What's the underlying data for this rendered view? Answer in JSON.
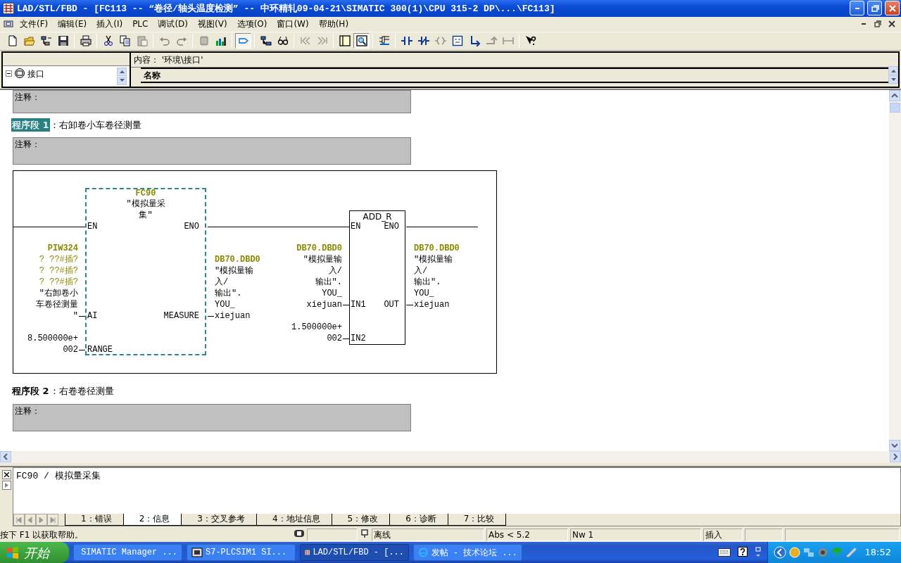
{
  "window": {
    "title": "LAD/STL/FBD  - [FC113 -- “卷径/轴头温度检测” -- 中环精轧09-04-21\\SIMATIC 300(1)\\CPU 315-2 DP\\...\\FC113]"
  },
  "menu": [
    "文件(F)",
    "编辑(E)",
    "插入(I)",
    "PLC",
    "调试(D)",
    "视图(V)",
    "选项(O)",
    "窗口(W)",
    "帮助(H)"
  ],
  "toolbar": [
    {
      "kind": "new",
      "disabled": false,
      "pressed": false
    },
    {
      "kind": "open",
      "disabled": false,
      "pressed": false
    },
    {
      "kind": "nodes",
      "disabled": false,
      "pressed": false
    },
    {
      "kind": "save",
      "disabled": false,
      "pressed": false
    },
    {
      "kind": "print",
      "disabled": false,
      "pressed": false
    },
    {
      "kind": "cut",
      "disabled": false,
      "pressed": false
    },
    {
      "kind": "copy",
      "disabled": false,
      "pressed": false
    },
    {
      "kind": "paste",
      "disabled": true,
      "pressed": false
    },
    {
      "kind": "undo",
      "disabled": true,
      "pressed": false
    },
    {
      "kind": "redo",
      "disabled": true,
      "pressed": false
    },
    {
      "kind": "chip",
      "disabled": true,
      "pressed": false
    },
    {
      "kind": "download",
      "disabled": false,
      "pressed": false
    },
    {
      "kind": "monitor",
      "disabled": false,
      "pressed": true
    },
    {
      "kind": "network",
      "disabled": false,
      "pressed": false
    },
    {
      "kind": "glasses",
      "disabled": false,
      "pressed": false
    },
    {
      "kind": "prev",
      "disabled": true,
      "pressed": false
    },
    {
      "kind": "next",
      "disabled": true,
      "pressed": false
    },
    {
      "kind": "overview",
      "disabled": false,
      "pressed": false
    },
    {
      "kind": "details",
      "disabled": false,
      "pressed": true
    },
    {
      "kind": "elements",
      "disabled": false,
      "pressed": false
    },
    {
      "kind": "contact",
      "disabled": false,
      "pressed": false
    },
    {
      "kind": "nccontact",
      "disabled": false,
      "pressed": false
    },
    {
      "kind": "coil",
      "disabled": true,
      "pressed": false
    },
    {
      "kind": "emptybox",
      "disabled": false,
      "pressed": false
    },
    {
      "kind": "branch",
      "disabled": false,
      "pressed": false
    },
    {
      "kind": "branchclose",
      "disabled": true,
      "pressed": false
    },
    {
      "kind": "connector",
      "disabled": true,
      "pressed": false
    },
    {
      "kind": "help",
      "disabled": false,
      "pressed": false
    }
  ],
  "interface_pane": {
    "tree": [
      {
        "label": "接口",
        "expanded": true
      }
    ],
    "content_path": "内容： '环境\\接口'",
    "columns": [
      "名称"
    ]
  },
  "editor": {
    "top_comment": "注释：",
    "networks": [
      {
        "label": "程序段 1",
        "title": "：右卸卷小车卷径测量",
        "selected": true,
        "comment": "注释：",
        "diagram": {
          "blocks": [
            {
              "kind": "call",
              "number": "FC90",
              "symbol_lines": [
                "″模拟量采",
                "集″"
              ],
              "selected": true,
              "inputs": [
                {
                  "pin": "EN"
                },
                {
                  "pin": "AI",
                  "address": "PIW324",
                  "comment_lines": [
                    "?  ??#插?",
                    "?  ??#插?",
                    "?  ??#插?"
                  ],
                  "lines": [
                    "″右卸卷小",
                    "车卷径测量",
                    "″"
                  ]
                },
                {
                  "pin": "RANGE",
                  "lines": [
                    "8.500000e+",
                    "002"
                  ]
                }
              ],
              "outputs": [
                {
                  "pin": "ENO"
                },
                {
                  "pin": "MEASURE",
                  "address": "DB70.DBD0",
                  "lines": [
                    "″模拟量输",
                    "入/",
                    "输出″.",
                    "YOU_",
                    "xiejuan"
                  ]
                }
              ]
            },
            {
              "kind": "box",
              "name": "ADD_R",
              "selected": false,
              "inputs": [
                {
                  "pin": "EN"
                },
                {
                  "pin": "IN1",
                  "address": "DB70.DBD0",
                  "lines": [
                    "″模拟量输",
                    "入/",
                    "输出″.",
                    "YOU_",
                    "xiejuan"
                  ]
                },
                {
                  "pin": "IN2",
                  "lines": [
                    "1.500000e+",
                    "002"
                  ]
                }
              ],
              "outputs": [
                {
                  "pin": "ENO"
                },
                {
                  "pin": "OUT",
                  "address": "DB70.DBD0",
                  "lines": [
                    "″模拟量输",
                    "入/",
                    "输出″.",
                    "YOU_",
                    "xiejuan"
                  ]
                }
              ]
            }
          ]
        }
      },
      {
        "label": "程序段 2",
        "title": "：右卷卷径测量",
        "selected": false,
        "comment": "注释："
      }
    ]
  },
  "details": {
    "text": "FC90 / 模拟量采集",
    "tabs": [
      {
        "label": "1：错误",
        "selected": false
      },
      {
        "label": "2：信息",
        "selected": true
      },
      {
        "label": "3：交叉参考",
        "selected": false
      },
      {
        "label": "4：地址信息",
        "selected": false
      },
      {
        "label": "5：修改",
        "selected": false
      },
      {
        "label": "6：诊断",
        "selected": false
      },
      {
        "label": "7：比较",
        "selected": false
      }
    ]
  },
  "status_bar": {
    "help": "按下 F1 以获取帮助。",
    "connection": "离线",
    "address": "Abs < 5.2",
    "network": "Nw 1",
    "mode": "插入"
  },
  "taskbar": {
    "start": "开始",
    "tasks": [
      {
        "kind": "manager",
        "label": "SIMATIC Manager ...",
        "selected": false
      },
      {
        "kind": "plcsim",
        "label": "S7-PLCSIM1    SI...",
        "selected": false
      },
      {
        "kind": "editor",
        "label": "LAD/STL/FBD  - [...",
        "selected": true
      },
      {
        "kind": "browser",
        "label": "发帖 - 技术论坛 ...",
        "selected": false
      }
    ],
    "clock": "18:52"
  }
}
